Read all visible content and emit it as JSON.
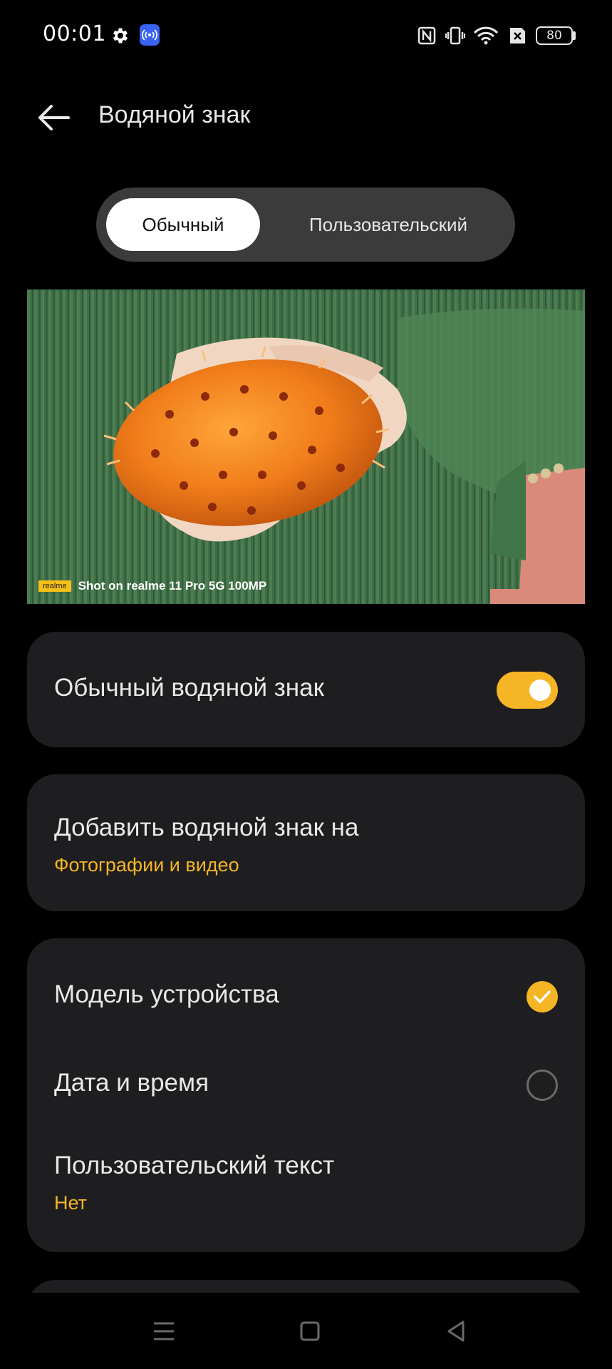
{
  "status_bar": {
    "time": "00:01",
    "battery": "80",
    "icons": [
      "gear-icon",
      "hotspot-icon",
      "nfc-icon",
      "vibrate-icon",
      "wifi-icon",
      "no-sim-icon",
      "battery-icon"
    ]
  },
  "header": {
    "title": "Водяной знак",
    "back_icon": "arrow-left-icon"
  },
  "tabs": [
    {
      "label": "Обычный",
      "selected": true
    },
    {
      "label": "Пользовательский",
      "selected": false
    }
  ],
  "preview": {
    "watermark_logo": "realme",
    "watermark_text": "Shot on realme 11 Pro 5G 100MP"
  },
  "standard_watermark": {
    "label": "Обычный водяной знак",
    "enabled": true
  },
  "add_watermark": {
    "label": "Добавить водяной знак на",
    "value": "Фотографии и видео"
  },
  "options": {
    "device_model": {
      "label": "Модель устройства",
      "checked": true
    },
    "date_time": {
      "label": "Дата и время",
      "checked": false
    },
    "custom_text": {
      "label": "Пользовательский текст",
      "value": "Нет"
    }
  },
  "colors": {
    "accent": "#f5b524",
    "card_bg": "#1e1e20",
    "background": "#000000"
  }
}
